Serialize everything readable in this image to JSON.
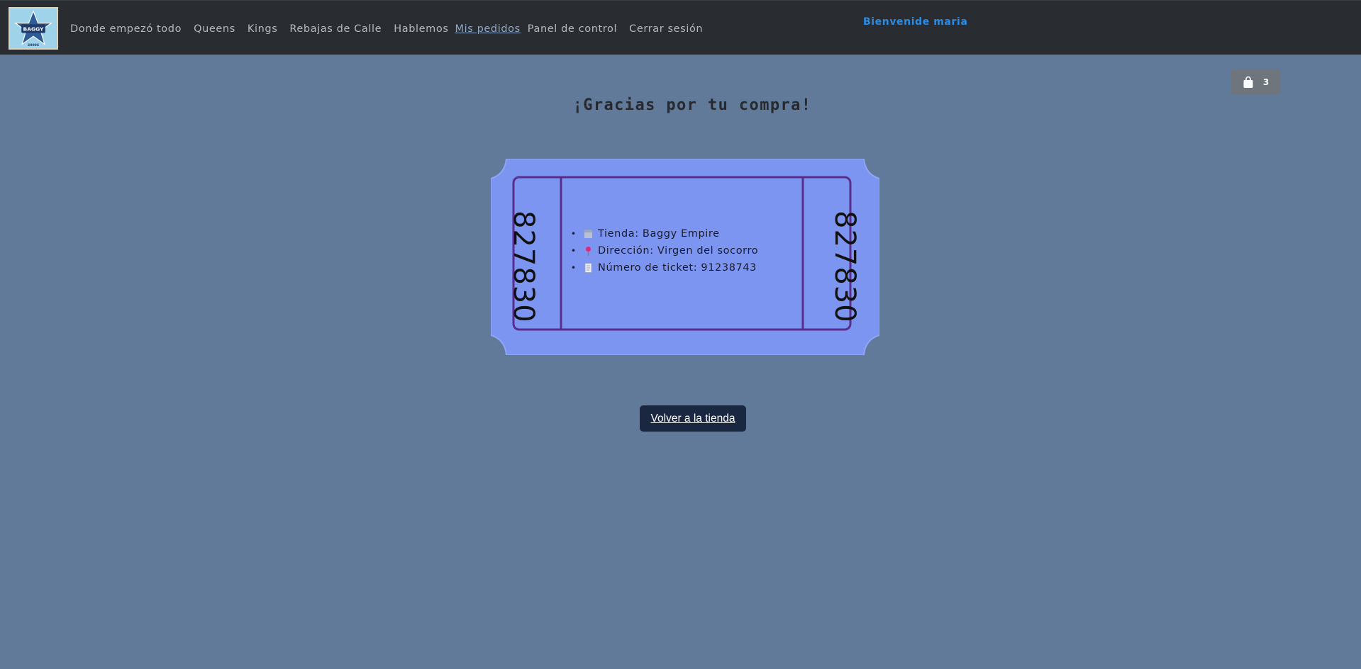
{
  "navbar": {
    "logo_text": "BAGGY EMPIRE",
    "links": [
      {
        "label": "Donde empezó todo"
      },
      {
        "label": "Queens"
      },
      {
        "label": "Kings"
      },
      {
        "label": "Rebajas de Calle"
      },
      {
        "label": "Hablemos"
      },
      {
        "label": "Mis pedidos",
        "active": true
      },
      {
        "label": "Panel de control"
      },
      {
        "label": "Cerrar sesión"
      }
    ],
    "welcome": "Bienvenide maria"
  },
  "cart": {
    "icon": "shopping-bag-icon",
    "count": "3"
  },
  "main": {
    "title": "¡Gracias por tu compra!",
    "ticket": {
      "stub_number": "827830",
      "info": [
        {
          "icon": "store-icon",
          "text": "Tienda: Baggy Empire"
        },
        {
          "icon": "pin-icon",
          "text": "Dirección: Virgen del socorro"
        },
        {
          "icon": "receipt-icon",
          "text": "Número de ticket: 91238743"
        }
      ]
    },
    "back_button": "Volver a la tienda"
  },
  "colors": {
    "page_bg": "#627a99",
    "navbar_bg": "#292d32",
    "welcome": "#2b8be3",
    "ticket": "#7c95f0",
    "ticket_border": "#5a2d8c",
    "button_bg": "#1a2740"
  }
}
